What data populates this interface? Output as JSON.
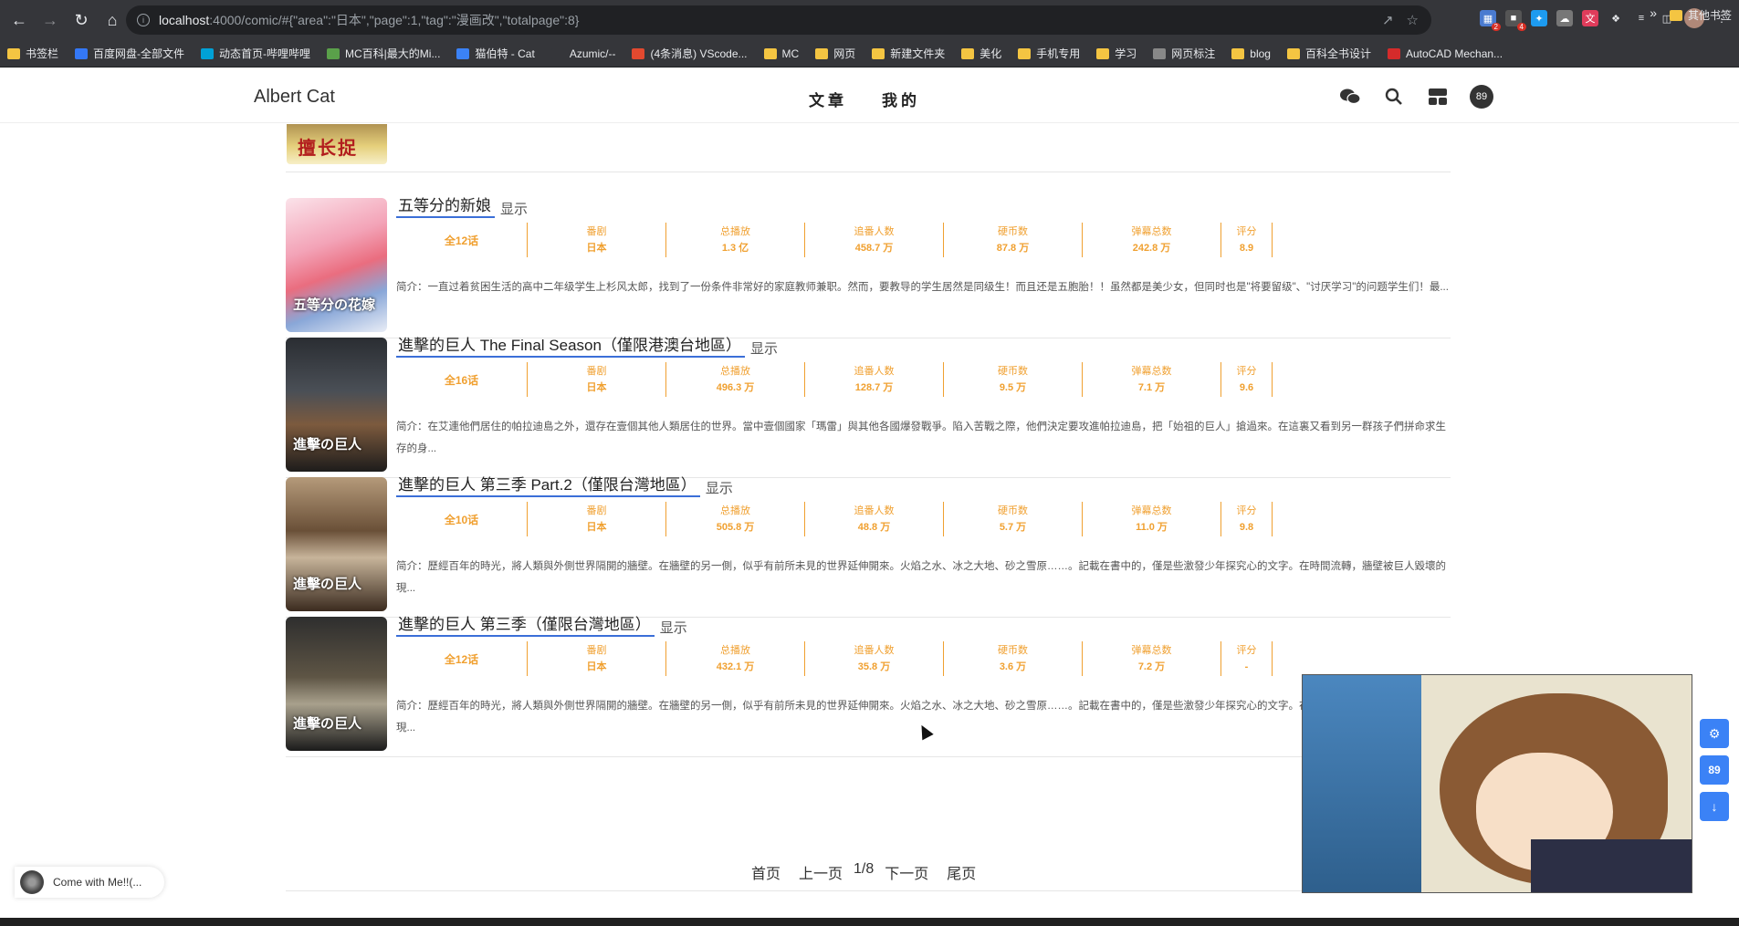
{
  "browser": {
    "url_host": "localhost",
    "url_path": ":4000/comic/#{\"area\":\"日本\",\"page\":1,\"tag\":\"漫画改\",\"totalpage\":8}",
    "ext_badge_1": "2",
    "ext_badge_2": "4"
  },
  "bookmarks": [
    {
      "label": "书签栏",
      "type": "folder"
    },
    {
      "label": "百度网盘-全部文件",
      "type": "link",
      "color": "#3478f6"
    },
    {
      "label": "动态首页-哔哩哔哩",
      "type": "link",
      "color": "#00a1d6"
    },
    {
      "label": "MC百科|最大的Mi...",
      "type": "link",
      "color": "#5aa04a"
    },
    {
      "label": "猫伯特 - Cat",
      "type": "link",
      "color": "#3b82f6"
    },
    {
      "label": "Azumic/--",
      "type": "link",
      "color": "#35363a"
    },
    {
      "label": "(4条消息) VScode...",
      "type": "link",
      "color": "#e2492f"
    },
    {
      "label": "MC",
      "type": "folder"
    },
    {
      "label": "网页",
      "type": "folder"
    },
    {
      "label": "新建文件夹",
      "type": "folder"
    },
    {
      "label": "美化",
      "type": "folder"
    },
    {
      "label": "手机专用",
      "type": "folder"
    },
    {
      "label": "学习",
      "type": "folder"
    },
    {
      "label": "网页标注",
      "type": "link",
      "color": "#888"
    },
    {
      "label": "blog",
      "type": "folder"
    },
    {
      "label": "百科全书设计",
      "type": "folder"
    },
    {
      "label": "AutoCAD Mechan...",
      "type": "link",
      "color": "#d52b2b"
    }
  ],
  "bookmarks_more": "»",
  "bookmarks_other": "其他书签",
  "site": {
    "brand": "Albert Cat",
    "menu": [
      "文章",
      "我的"
    ],
    "badge": "89"
  },
  "top_item": {
    "cover_text": "擅长捉"
  },
  "stat_labels": [
    "番剧",
    "总播放",
    "追番人数",
    "硬币数",
    "弹幕总数",
    "评分"
  ],
  "items": [
    {
      "title": "五等分的新娘",
      "show": "显示",
      "episodes": "全12话",
      "area": "日本",
      "play": "1.3 亿",
      "follow": "458.7 万",
      "coins": "87.8 万",
      "danmaku": "242.8 万",
      "score": "8.9",
      "desc": "简介：一直过着贫困生活的高中二年级学生上杉风太郎，找到了一份条件非常好的家庭教师兼职。然而，要教导的学生居然是同级生！而且还是五胞胎！！虽然都是美少女，但同时也是\"将要留级\"、\"讨厌学习\"的问题学生们！最...",
      "cover_text": "五等分の花嫁"
    },
    {
      "title": "進擊的巨人 The Final Season（僅限港澳台地區）",
      "show": "显示",
      "episodes": "全16话",
      "area": "日本",
      "play": "496.3 万",
      "follow": "128.7 万",
      "coins": "9.5 万",
      "danmaku": "7.1 万",
      "score": "9.6",
      "desc": "简介：在艾連他們居住的帕拉迪島之外，還存在壹個其他人類居住的世界。當中壹個國家「瑪雷」與其他各國爆發戰爭。陷入苦戰之際，他們決定要攻進帕拉迪島，把「始祖的巨人」搶過來。在這裏又看到另一群孩子們拼命求生存的身...",
      "cover_text": "進擊の巨人"
    },
    {
      "title": "進擊的巨人 第三季 Part.2（僅限台灣地區）",
      "show": "显示",
      "episodes": "全10话",
      "area": "日本",
      "play": "505.8 万",
      "follow": "48.8 万",
      "coins": "5.7 万",
      "danmaku": "11.0 万",
      "score": "9.8",
      "desc": "简介：歷經百年的時光，將人類與外側世界隔開的牆壁。在牆壁的另一側，似乎有前所未見的世界延伸開來。火焰之水、冰之大地、砂之雪原……。記載在書中的，僅是些激發少年探究心的文字。在時間流轉，牆壁被巨人毀壞的現...",
      "cover_text": "進擊の巨人"
    },
    {
      "title": "進擊的巨人 第三季（僅限台灣地區）",
      "show": "显示",
      "episodes": "全12话",
      "area": "日本",
      "play": "432.1 万",
      "follow": "35.8 万",
      "coins": "3.6 万",
      "danmaku": "7.2 万",
      "score": "-",
      "desc": "简介：歷經百年的時光，將人類與外側世界隔開的牆壁。在牆壁的另一側，似乎有前所未見的世界延伸開來。火焰之水、冰之大地、砂之雪原……。記載在書中的，僅是些激發少年探究心的文字。在時間流轉，牆壁被巨人毀壞的現...",
      "cover_text": "進擊の巨人"
    }
  ],
  "pager": {
    "first": "首页",
    "prev": "上一页",
    "current": "1/8",
    "next": "下一页",
    "last": "尾页"
  },
  "fab": {
    "badge": "89"
  },
  "music": {
    "title": "Come with Me!!(..."
  }
}
